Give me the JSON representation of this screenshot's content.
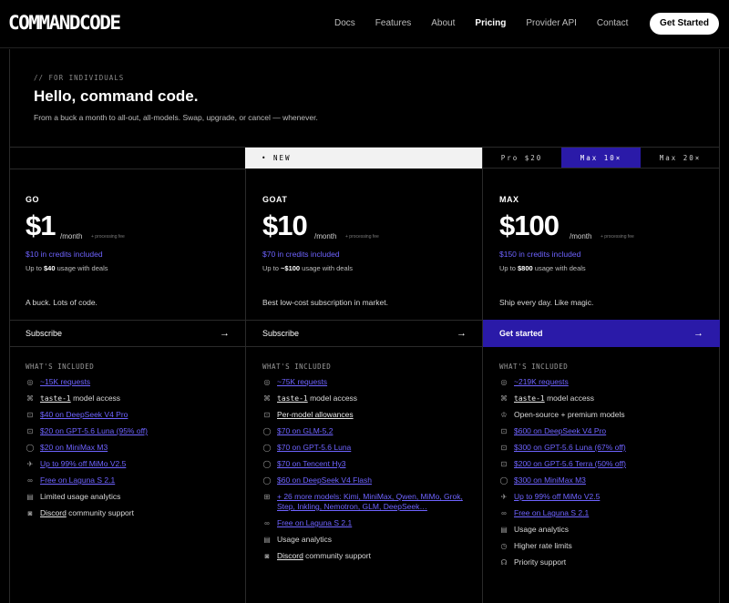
{
  "nav": {
    "logo": "COMMANDCODE",
    "links": [
      "Docs",
      "Features",
      "About",
      "Pricing",
      "Provider API",
      "Contact"
    ],
    "active": "Pricing",
    "cta": "Get Started"
  },
  "hero": {
    "tag": "// FOR INDIVIDUALS",
    "title": "Hello, command code.",
    "subtitle": "From a buck a month to all-out, all-models. Swap, upgrade, or cancel — whenever."
  },
  "new_banner": "• NEW",
  "tier_switch": [
    "Pro $20",
    "Max 10×",
    "Max 20×"
  ],
  "tier_selected": "Max 10×",
  "accent": "#2a1aa8",
  "link_color": "#6e63ff",
  "included_label": "WHAT'S INCLUDED",
  "plans": [
    {
      "name": "GO",
      "price": "$1",
      "per": "/month",
      "fee": "+ processing fee",
      "credits": "$10 in credits included",
      "usage_pre": "Up to ",
      "usage_amt": "$40",
      "usage_post": " usage with deals",
      "tagline": "A buck. Lots of code.",
      "button": "Subscribe",
      "primary": false,
      "features": [
        {
          "icon": "◎",
          "link": "~15K requests",
          "rest": ""
        },
        {
          "icon": "⌘",
          "mono": "taste-1",
          "rest": " model access"
        },
        {
          "icon": "⊡",
          "link": "$40 on DeepSeek V4 Pro",
          "rest": ""
        },
        {
          "icon": "⊡",
          "link": "$20 on GPT-5.6 Luna (95% off)",
          "rest": ""
        },
        {
          "icon": "◯",
          "link": "$20 on MiniMax M3",
          "rest": ""
        },
        {
          "icon": "✈",
          "link": "Up to 99% off MiMo V2.5",
          "rest": ""
        },
        {
          "icon": "∞",
          "link": "Free on Laguna S 2.1",
          "rest": ""
        },
        {
          "icon": "▤",
          "text": "Limited usage analytics",
          "rest": ""
        },
        {
          "icon": "◙",
          "ul": "Discord",
          "rest": " community support"
        }
      ]
    },
    {
      "name": "GOAT",
      "price": "$10",
      "per": "/month",
      "fee": "+ processing fee",
      "credits": "$70 in credits included",
      "usage_pre": "Up to ",
      "usage_amt": "~$100",
      "usage_post": " usage with deals",
      "tagline": "Best low-cost subscription in market.",
      "button": "Subscribe",
      "primary": false,
      "features": [
        {
          "icon": "◎",
          "link": "~75K requests",
          "rest": ""
        },
        {
          "icon": "⌘",
          "mono": "taste-1",
          "rest": " model access"
        },
        {
          "icon": "⊡",
          "ul": "Per-model allowances",
          "rest": ""
        },
        {
          "icon": "◯",
          "link": "$70 on GLM-5.2",
          "rest": ""
        },
        {
          "icon": "◯",
          "link": "$70 on GPT-5.6 Luna",
          "rest": ""
        },
        {
          "icon": "◯",
          "link": "$70 on Tencent Hy3",
          "rest": ""
        },
        {
          "icon": "◯",
          "link": "$60 on DeepSeek V4 Flash",
          "rest": ""
        },
        {
          "icon": "⊞",
          "link": "+ 26 more models: Kimi, MiniMax, Qwen, MiMo, Grok, Step, Inkling, Nemotron, GLM, DeepSeek…",
          "rest": ""
        },
        {
          "icon": "∞",
          "link": "Free on Laguna S 2.1",
          "rest": ""
        },
        {
          "icon": "▤",
          "text": "Usage analytics",
          "rest": ""
        },
        {
          "icon": "◙",
          "ul": "Discord",
          "rest": " community support"
        }
      ]
    },
    {
      "name": "MAX",
      "price": "$100",
      "per": "/month",
      "fee": "+ processing fee",
      "credits": "$150 in credits included",
      "usage_pre": "Up to ",
      "usage_amt": "$800",
      "usage_post": " usage with deals",
      "tagline": "Ship every day. Like magic.",
      "button": "Get started",
      "primary": true,
      "features": [
        {
          "icon": "◎",
          "link": "~219K requests",
          "rest": ""
        },
        {
          "icon": "⌘",
          "mono": "taste-1",
          "rest": " model access"
        },
        {
          "icon": "♔",
          "text": "Open-source + premium models",
          "rest": ""
        },
        {
          "icon": "⊡",
          "link": "$600 on DeepSeek V4 Pro",
          "rest": ""
        },
        {
          "icon": "⊡",
          "link": "$300 on GPT-5.6 Luna (67% off)",
          "rest": ""
        },
        {
          "icon": "⊡",
          "link": "$200 on GPT-5.6 Terra (50% off)",
          "rest": ""
        },
        {
          "icon": "◯",
          "link": "$300 on MiniMax M3",
          "rest": ""
        },
        {
          "icon": "✈",
          "link": "Up to 99% off MiMo V2.5",
          "rest": ""
        },
        {
          "icon": "∞",
          "link": "Free on Laguna S 2.1",
          "rest": ""
        },
        {
          "icon": "▤",
          "text": "Usage analytics",
          "rest": ""
        },
        {
          "icon": "◷",
          "text": "Higher rate limits",
          "rest": ""
        },
        {
          "icon": "☊",
          "text": "Priority support",
          "rest": ""
        }
      ]
    }
  ]
}
